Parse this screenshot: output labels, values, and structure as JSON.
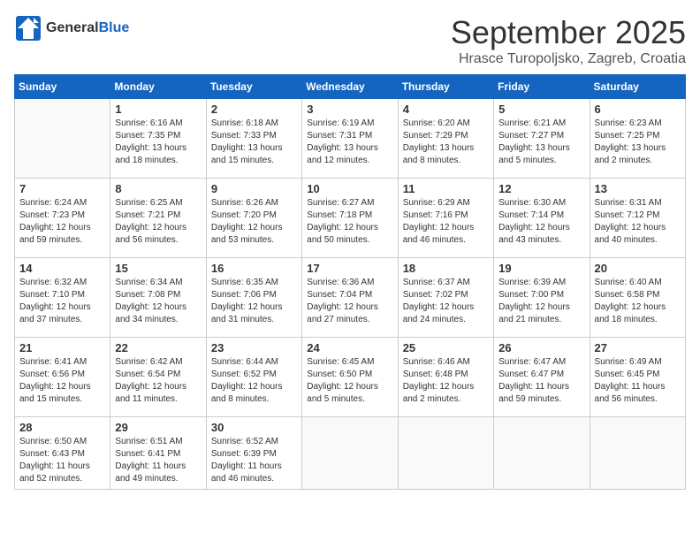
{
  "header": {
    "logo": {
      "text_general": "General",
      "text_blue": "Blue"
    },
    "month_title": "September 2025",
    "location": "Hrasce Turopoljsko, Zagreb, Croatia"
  },
  "weekdays": [
    "Sunday",
    "Monday",
    "Tuesday",
    "Wednesday",
    "Thursday",
    "Friday",
    "Saturday"
  ],
  "weeks": [
    [
      {
        "day": "",
        "info": ""
      },
      {
        "day": "1",
        "info": "Sunrise: 6:16 AM\nSunset: 7:35 PM\nDaylight: 13 hours\nand 18 minutes."
      },
      {
        "day": "2",
        "info": "Sunrise: 6:18 AM\nSunset: 7:33 PM\nDaylight: 13 hours\nand 15 minutes."
      },
      {
        "day": "3",
        "info": "Sunrise: 6:19 AM\nSunset: 7:31 PM\nDaylight: 13 hours\nand 12 minutes."
      },
      {
        "day": "4",
        "info": "Sunrise: 6:20 AM\nSunset: 7:29 PM\nDaylight: 13 hours\nand 8 minutes."
      },
      {
        "day": "5",
        "info": "Sunrise: 6:21 AM\nSunset: 7:27 PM\nDaylight: 13 hours\nand 5 minutes."
      },
      {
        "day": "6",
        "info": "Sunrise: 6:23 AM\nSunset: 7:25 PM\nDaylight: 13 hours\nand 2 minutes."
      }
    ],
    [
      {
        "day": "7",
        "info": "Sunrise: 6:24 AM\nSunset: 7:23 PM\nDaylight: 12 hours\nand 59 minutes."
      },
      {
        "day": "8",
        "info": "Sunrise: 6:25 AM\nSunset: 7:21 PM\nDaylight: 12 hours\nand 56 minutes."
      },
      {
        "day": "9",
        "info": "Sunrise: 6:26 AM\nSunset: 7:20 PM\nDaylight: 12 hours\nand 53 minutes."
      },
      {
        "day": "10",
        "info": "Sunrise: 6:27 AM\nSunset: 7:18 PM\nDaylight: 12 hours\nand 50 minutes."
      },
      {
        "day": "11",
        "info": "Sunrise: 6:29 AM\nSunset: 7:16 PM\nDaylight: 12 hours\nand 46 minutes."
      },
      {
        "day": "12",
        "info": "Sunrise: 6:30 AM\nSunset: 7:14 PM\nDaylight: 12 hours\nand 43 minutes."
      },
      {
        "day": "13",
        "info": "Sunrise: 6:31 AM\nSunset: 7:12 PM\nDaylight: 12 hours\nand 40 minutes."
      }
    ],
    [
      {
        "day": "14",
        "info": "Sunrise: 6:32 AM\nSunset: 7:10 PM\nDaylight: 12 hours\nand 37 minutes."
      },
      {
        "day": "15",
        "info": "Sunrise: 6:34 AM\nSunset: 7:08 PM\nDaylight: 12 hours\nand 34 minutes."
      },
      {
        "day": "16",
        "info": "Sunrise: 6:35 AM\nSunset: 7:06 PM\nDaylight: 12 hours\nand 31 minutes."
      },
      {
        "day": "17",
        "info": "Sunrise: 6:36 AM\nSunset: 7:04 PM\nDaylight: 12 hours\nand 27 minutes."
      },
      {
        "day": "18",
        "info": "Sunrise: 6:37 AM\nSunset: 7:02 PM\nDaylight: 12 hours\nand 24 minutes."
      },
      {
        "day": "19",
        "info": "Sunrise: 6:39 AM\nSunset: 7:00 PM\nDaylight: 12 hours\nand 21 minutes."
      },
      {
        "day": "20",
        "info": "Sunrise: 6:40 AM\nSunset: 6:58 PM\nDaylight: 12 hours\nand 18 minutes."
      }
    ],
    [
      {
        "day": "21",
        "info": "Sunrise: 6:41 AM\nSunset: 6:56 PM\nDaylight: 12 hours\nand 15 minutes."
      },
      {
        "day": "22",
        "info": "Sunrise: 6:42 AM\nSunset: 6:54 PM\nDaylight: 12 hours\nand 11 minutes."
      },
      {
        "day": "23",
        "info": "Sunrise: 6:44 AM\nSunset: 6:52 PM\nDaylight: 12 hours\nand 8 minutes."
      },
      {
        "day": "24",
        "info": "Sunrise: 6:45 AM\nSunset: 6:50 PM\nDaylight: 12 hours\nand 5 minutes."
      },
      {
        "day": "25",
        "info": "Sunrise: 6:46 AM\nSunset: 6:48 PM\nDaylight: 12 hours\nand 2 minutes."
      },
      {
        "day": "26",
        "info": "Sunrise: 6:47 AM\nSunset: 6:47 PM\nDaylight: 11 hours\nand 59 minutes."
      },
      {
        "day": "27",
        "info": "Sunrise: 6:49 AM\nSunset: 6:45 PM\nDaylight: 11 hours\nand 56 minutes."
      }
    ],
    [
      {
        "day": "28",
        "info": "Sunrise: 6:50 AM\nSunset: 6:43 PM\nDaylight: 11 hours\nand 52 minutes."
      },
      {
        "day": "29",
        "info": "Sunrise: 6:51 AM\nSunset: 6:41 PM\nDaylight: 11 hours\nand 49 minutes."
      },
      {
        "day": "30",
        "info": "Sunrise: 6:52 AM\nSunset: 6:39 PM\nDaylight: 11 hours\nand 46 minutes."
      },
      {
        "day": "",
        "info": ""
      },
      {
        "day": "",
        "info": ""
      },
      {
        "day": "",
        "info": ""
      },
      {
        "day": "",
        "info": ""
      }
    ]
  ]
}
